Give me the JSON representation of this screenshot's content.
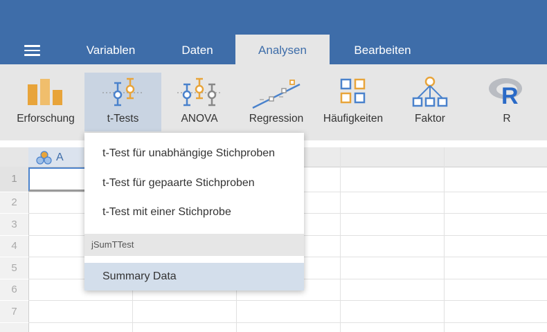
{
  "menu": {
    "icon": "hamburger-menu-icon"
  },
  "tabs": [
    {
      "label": "Variablen",
      "active": false
    },
    {
      "label": "Daten",
      "active": false
    },
    {
      "label": "Analysen",
      "active": true
    },
    {
      "label": "Bearbeiten",
      "active": false
    }
  ],
  "ribbon": {
    "buttons": [
      {
        "label": "Erforschung",
        "icon": "exploration-bar-chart-icon"
      },
      {
        "label": "t-Tests",
        "icon": "t-tests-icon",
        "selected": true
      },
      {
        "label": "ANOVA",
        "icon": "anova-icon"
      },
      {
        "label": "Regression",
        "icon": "regression-icon"
      },
      {
        "label": "Häufigkeiten",
        "icon": "frequencies-icon"
      },
      {
        "label": "Faktor",
        "icon": "factor-icon"
      },
      {
        "label": "R",
        "icon": "r-logo-icon"
      }
    ]
  },
  "spreadsheet": {
    "column_a": "A",
    "column_a_icon": "nominal-variable-icon",
    "row_numbers": [
      "1",
      "2",
      "3",
      "4",
      "5",
      "6",
      "7"
    ]
  },
  "dropdown": {
    "items": [
      "t-Test für unabhängige Stichproben",
      "t-Test für gepaarte Stichproben",
      "t-Test mit einer Stichprobe"
    ],
    "section_label": "jSumTTest",
    "module_item": "Summary Data"
  },
  "colors": {
    "accent": "#3e6da9",
    "ribbon": "#e6e6e6",
    "highlight": "#d3deeb",
    "icon_orange": "#e8a43a"
  }
}
